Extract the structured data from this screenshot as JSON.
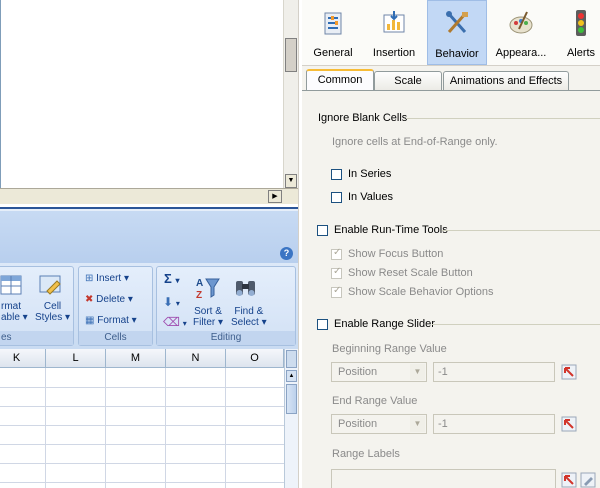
{
  "toolbar": {
    "buttons": [
      {
        "label": "General",
        "icon": "general-icon"
      },
      {
        "label": "Insertion",
        "icon": "insertion-icon"
      },
      {
        "label": "Behavior",
        "icon": "behavior-icon",
        "active": true
      },
      {
        "label": "Appeara...",
        "icon": "appearance-icon"
      },
      {
        "label": "Alerts",
        "icon": "alerts-icon"
      }
    ]
  },
  "tabs": [
    "Common",
    "Scale",
    "Animations and Effects"
  ],
  "active_tab": "Common",
  "content": {
    "ignore_blank": {
      "title": "Ignore Blank Cells",
      "desc": "Ignore cells at End-of-Range only.",
      "in_series": "In Series",
      "in_values": "In Values"
    },
    "runtime": {
      "label": "Enable Run-Time Tools",
      "show_focus": "Show Focus Button",
      "show_reset": "Show Reset Scale Button",
      "show_behavior": "Show Scale Behavior Options"
    },
    "range_slider": {
      "label": "Enable Range Slider",
      "begin_label": "Beginning Range Value",
      "begin_select": "Position",
      "begin_value": "-1",
      "end_label": "End Range Value",
      "end_select": "Position",
      "end_value": "-1",
      "range_labels": "Range Labels"
    }
  },
  "excel": {
    "help": "?",
    "cells_group": {
      "insert": "Insert",
      "delete": "Delete",
      "format": "Format",
      "label": "Cells"
    },
    "editing_group": {
      "sigma": "Σ",
      "sort_filter_1": "Sort &",
      "sort_filter_2": "Filter",
      "find_select_1": "Find &",
      "find_select_2": "Select",
      "label": "Editing"
    },
    "styles_group": {
      "format_table_1": "rmat",
      "format_table_2": "able",
      "cell_styles_1": "Cell",
      "cell_styles_2": "Styles",
      "label": "es"
    },
    "columns": [
      "K",
      "L",
      "M",
      "N",
      "O"
    ]
  },
  "colors": {
    "accent_tab": "#f7bc37",
    "active_toolbar": "#c2d8f5",
    "ribbon": "#c9dbf2"
  }
}
